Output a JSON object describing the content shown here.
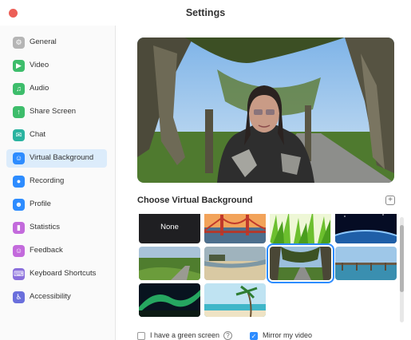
{
  "window": {
    "title": "Settings"
  },
  "sidebar": {
    "items": [
      {
        "label": "General",
        "icon": "gear-icon",
        "color": "#b5b5b5",
        "active": false
      },
      {
        "label": "Video",
        "icon": "video-camera-icon",
        "color": "#3dbd6b",
        "active": false
      },
      {
        "label": "Audio",
        "icon": "headphones-icon",
        "color": "#3dbd6b",
        "active": false
      },
      {
        "label": "Share Screen",
        "icon": "share-screen-icon",
        "color": "#3dbd6b",
        "active": false
      },
      {
        "label": "Chat",
        "icon": "chat-bubble-icon",
        "color": "#2ab3a0",
        "active": false
      },
      {
        "label": "Virtual Background",
        "icon": "person-background-icon",
        "color": "#2d8cff",
        "active": true
      },
      {
        "label": "Recording",
        "icon": "record-icon",
        "color": "#2d8cff",
        "active": false
      },
      {
        "label": "Profile",
        "icon": "profile-icon",
        "color": "#2d8cff",
        "active": false
      },
      {
        "label": "Statistics",
        "icon": "statistics-icon",
        "color": "#c36adc",
        "active": false
      },
      {
        "label": "Feedback",
        "icon": "feedback-icon",
        "color": "#c36adc",
        "active": false
      },
      {
        "label": "Keyboard Shortcuts",
        "icon": "keyboard-icon",
        "color": "#8a6fdc",
        "active": false
      },
      {
        "label": "Accessibility",
        "icon": "accessibility-icon",
        "color": "#6a6fdc",
        "active": false
      }
    ]
  },
  "main": {
    "section_title": "Choose Virtual Background",
    "add_icon": "plus-icon",
    "backgrounds": [
      {
        "label": "None",
        "theme": "none",
        "selected": false
      },
      {
        "label": "",
        "theme": "golden-gate-bridge",
        "selected": false
      },
      {
        "label": "",
        "theme": "grass",
        "selected": false
      },
      {
        "label": "",
        "theme": "earth-from-space",
        "selected": false
      },
      {
        "label": "",
        "theme": "green-field",
        "selected": false
      },
      {
        "label": "",
        "theme": "beach-shore",
        "selected": false
      },
      {
        "label": "",
        "theme": "tree-avenue",
        "selected": true
      },
      {
        "label": "",
        "theme": "pier",
        "selected": false
      },
      {
        "label": "",
        "theme": "aurora",
        "selected": false
      },
      {
        "label": "",
        "theme": "palm-beach",
        "selected": false
      }
    ],
    "green_screen": {
      "label": "I have a green screen",
      "checked": false,
      "help_icon": "question-icon"
    },
    "mirror_video": {
      "label": "Mirror my video",
      "checked": true
    }
  }
}
